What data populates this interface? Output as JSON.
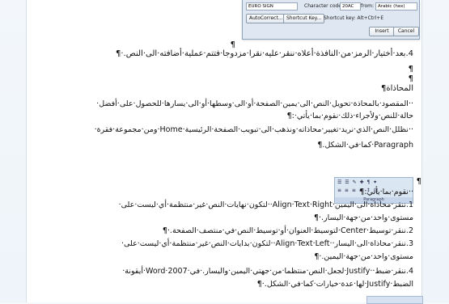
{
  "dialog": {
    "font_name": "EURO SIGN",
    "character_code_label": "Character code:",
    "character_code_value": "20AC",
    "from_label": "from:",
    "from_value": "Arabic (hex)",
    "autocorrect_label": "AutoCorrect...",
    "shortcut_key_label": "Shortcut Key...",
    "shortcut_text": "Shortcut key: Alt+Ctrl+E",
    "insert_label": "Insert",
    "cancel_label": "Cancel"
  },
  "document": {
    "lines": [
      {
        "text": "¶"
      },
      {
        "text": "4.بعد·أختيار·الرمز·من·النافذة·أعلاه·ننقر·عليه·نقرا·مزدوجا·فتتم·عملية·أضافته·الى·النص.·¶"
      },
      {
        "text": "¶"
      },
      {
        "text": "¶"
      },
      {
        "text": "المحاذاة¶"
      },
      {
        "text": "··المقصود·بالمحاذة·تحويل·النص·الى·يمين·الصفحة·أو·الى·وسطها·أو·الى·يسارها·للحصول·على·أفضل·"
      },
      {
        "text": "حالة·للنص·ولأجراء·ذلك·نقوم·بما·يأتي·:¶"
      },
      {
        "text": "··نظلل·النص·الذي·نريد·تغيير·محاذاته·ونذهب·الى·تبويب·الصفحة·الرئيسية·Home·ومن·مجموعة·فقرة·"
      },
      {
        "text": "Paragraph·كما·في·الشكل.¶"
      },
      {
        "text": "¶"
      },
      {
        "text": "··نقوم·بما·يأتي:¶"
      },
      {
        "text": "1.ننقر·محاذاة·الى·اليمين·Align·Text·Right··لتكون·نهايات·النص·غير·منتظمة·أي·ليست·على·"
      },
      {
        "text": "مستوى·واحد·من·جهة·اليسار.·¶"
      },
      {
        "text": "2.ننقر·توسيط·Center·لتوسيط·العنوان·أو·توسيط·النص·في·منتصف·الصفحة.·¶"
      },
      {
        "text": "3.ننقر·محاذاة·الى·اليسار··Align·Text·Left··لتكون·بدايات·النص·غير·منتظمة·أي·ليست·على·"
      },
      {
        "text": "مستوى·واحد·من·جهة·اليمين.·¶"
      },
      {
        "text": "4.ننقر·ضبط··Justify·لجعل·النص·منتظما·من·جهتي·اليمين·واليسار.·في·Word·2007·أيقونة·"
      },
      {
        "text": "الضبط·Justify·لها·عدة·خيارات·كما·في·الشكل.·¶"
      }
    ]
  },
  "ribbon": {
    "row1": "☰ ☰ ✎ ✚ ¶ ✦",
    "row2": "≡ ≡ ≡ ≡ ↕ ◫",
    "caption": "Paragraph"
  }
}
